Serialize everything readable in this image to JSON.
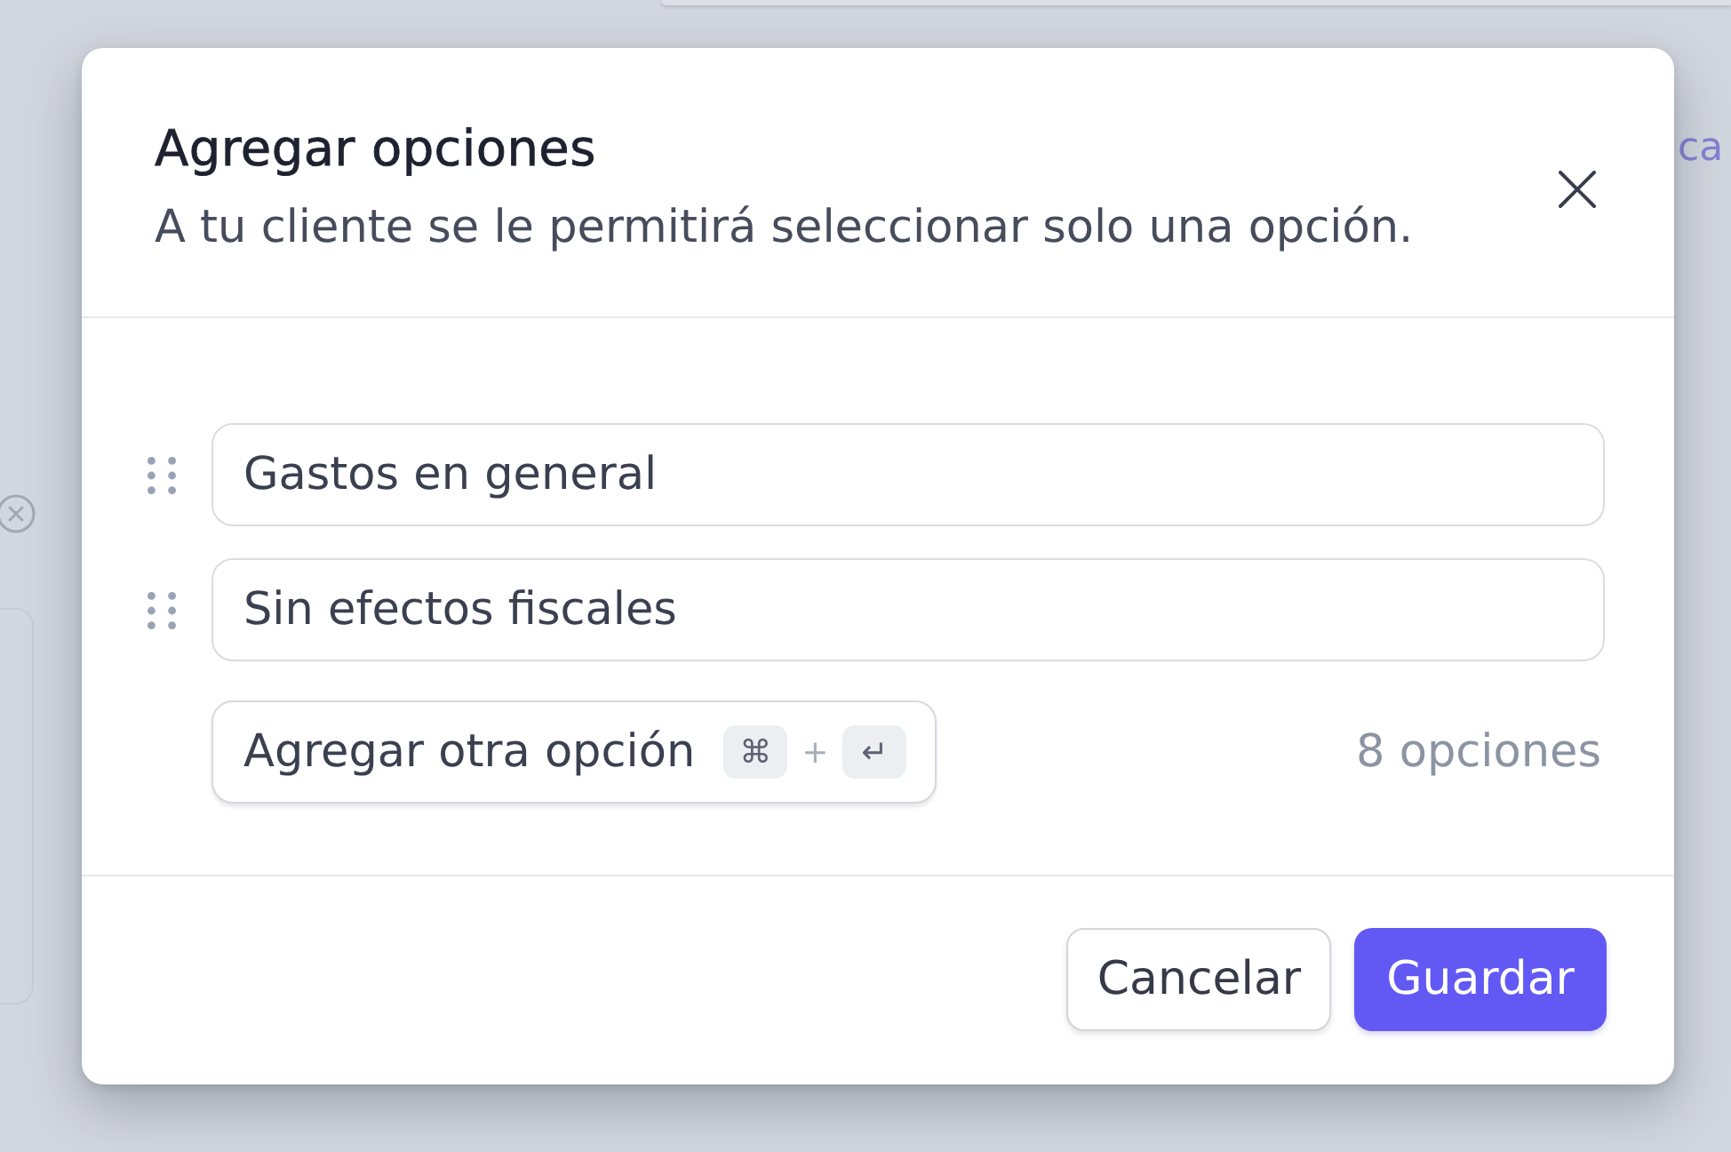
{
  "background": {
    "link_text": "ca"
  },
  "dialog": {
    "title": "Agregar opciones",
    "subtitle": "A tu cliente se le permitirá seleccionar solo una opción.",
    "options": [
      {
        "value": "Gastos en general"
      },
      {
        "value": "Sin efectos fiscales"
      }
    ],
    "add_button": {
      "label": "Agregar otra opción",
      "shortcut": {
        "keys": [
          "⌘",
          "↵"
        ],
        "separator": "+"
      }
    },
    "option_count": "8 opciones",
    "buttons": [
      {
        "label": "Cancelar",
        "kind": "secondary"
      },
      {
        "label": "Guardar",
        "kind": "primary"
      }
    ]
  }
}
